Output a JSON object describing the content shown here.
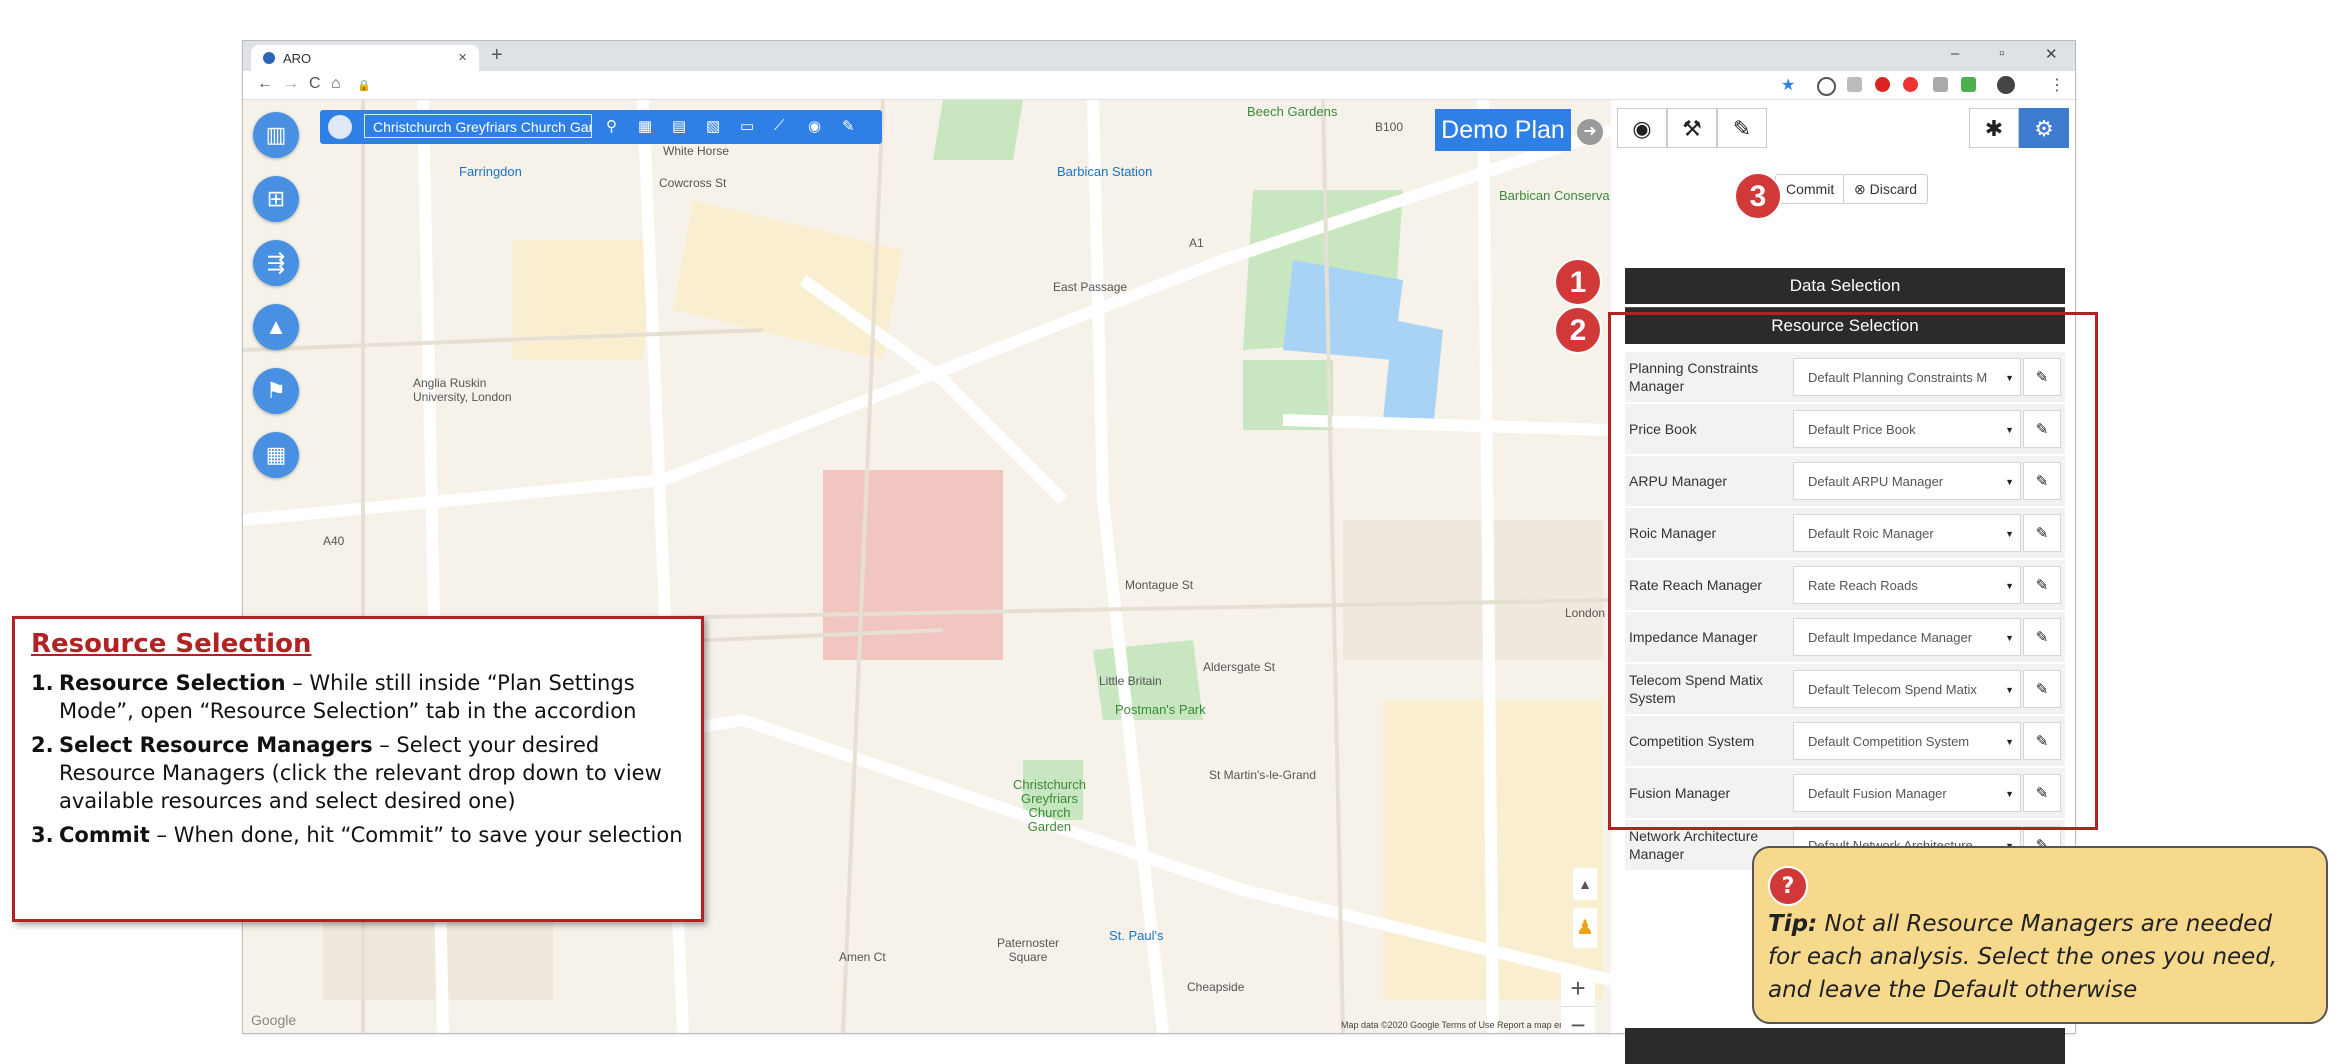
{
  "browser": {
    "tab_title": "ARO",
    "new_tab": "+",
    "window_controls": {
      "minimize": "–",
      "maximize": "▫",
      "close": "✕"
    },
    "nav": {
      "back": "←",
      "forward": "→",
      "reload": "C",
      "home": "⌂"
    }
  },
  "map": {
    "search_value": "Christchurch Greyfriars Church Gar...",
    "labels": {
      "farringdon": "Farringdon",
      "barbican_station": "Barbican Station",
      "beech_gardens": "Beech Gardens",
      "barbican_conserva": "Barbican Conserva",
      "postmans_park": "Postman's Park",
      "christchurch": "Christchurch\nGreyfriars\nChurch\nGarden",
      "st_pauls": "St. Paul's",
      "anglia_ruskin": "Anglia Ruskin\nUniversity, London",
      "montague_st": "Montague St",
      "a40": "A40",
      "london": "London",
      "white_horse": "White Horse",
      "cowcross": "Cowcross St",
      "east_passage": "East Passage",
      "little_britain": "Little Britain",
      "aldersgate": "Aldersgate St",
      "st_martins": "St Martin's-le-Grand",
      "paternoster": "Paternoster\nSquare",
      "amen_ct": "Amen Ct",
      "b100": "B100",
      "a1": "A1",
      "cheapside": "Cheapside",
      "google": "Google",
      "map_data": "Map data ©2020 Google   Terms of Use   Report a map error"
    },
    "zoom_in": "+",
    "zoom_out": "−"
  },
  "plan": {
    "title": "Demo Plan",
    "commit_label": "Commit",
    "discard_label": "Discard"
  },
  "panel": {
    "data_selection": "Data Selection",
    "resource_selection": "Resource Selection",
    "rows": [
      {
        "label": "Planning Constraints Manager",
        "value": "Default Planning Constraints M"
      },
      {
        "label": "Price Book",
        "value": "Default Price Book"
      },
      {
        "label": "ARPU Manager",
        "value": "Default ARPU Manager"
      },
      {
        "label": "Roic Manager",
        "value": "Default Roic Manager"
      },
      {
        "label": "Rate Reach Manager",
        "value": "Rate Reach Roads"
      },
      {
        "label": "Impedance Manager",
        "value": "Default Impedance Manager"
      },
      {
        "label": "Telecom Spend Matix System",
        "value": "Default Telecom Spend Matix"
      },
      {
        "label": "Competition System",
        "value": "Default Competition System"
      },
      {
        "label": "Fusion Manager",
        "value": "Default Fusion Manager"
      },
      {
        "label": "Network Architecture Manager",
        "value": "Default Network Architecture"
      }
    ]
  },
  "badges": {
    "one": "1",
    "two": "2",
    "three": "3"
  },
  "callout": {
    "title": "Resource Selection",
    "steps": [
      {
        "num": "1.",
        "bold": "Resource Selection",
        "text": " – While still inside “Plan Settings Mode”, open “Resource Selection” tab in the accordion"
      },
      {
        "num": "2.",
        "bold": "Select Resource Managers",
        "text": " – Select your desired Resource Managers (click the relevant drop down to view available resources and select desired one)"
      },
      {
        "num": "3.",
        "bold": "Commit",
        "text": "  – When done, hit “Commit” to save your selection"
      }
    ]
  },
  "tip": {
    "icon": "?",
    "bold": "Tip:",
    "text": " Not all Resource Managers are needed for each analysis. Select the ones you need, and leave the Default otherwise"
  },
  "colors": {
    "accent": "#2f80e6",
    "highlight": "#b22222",
    "tip_bg": "#f7d98d"
  }
}
